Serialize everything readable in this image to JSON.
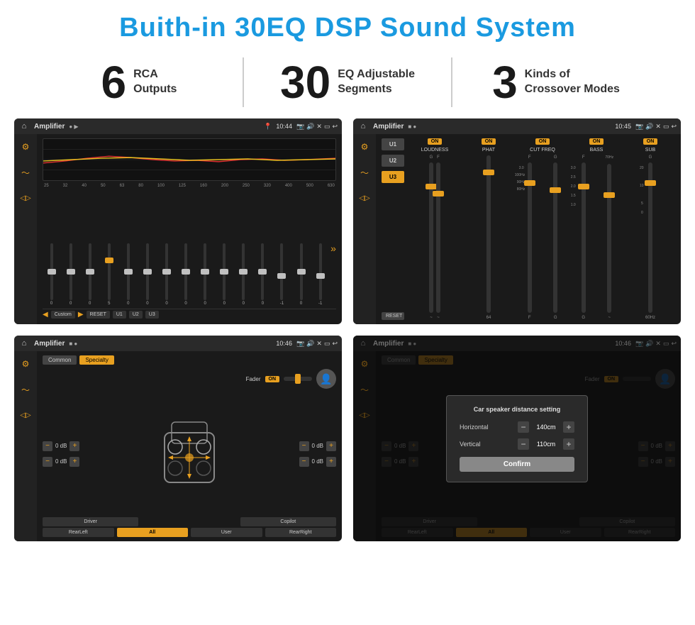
{
  "title": "Buith-in 30EQ DSP Sound System",
  "stats": [
    {
      "number": "6",
      "label": "RCA\nOutputs"
    },
    {
      "number": "30",
      "label": "EQ Adjustable\nSegments"
    },
    {
      "number": "3",
      "label": "Kinds of\nCrossover Modes"
    }
  ],
  "screens": [
    {
      "id": "eq-screen",
      "topbar": {
        "title": "Amplifier",
        "time": "10:44"
      },
      "type": "eq",
      "freq_labels": [
        "25",
        "32",
        "40",
        "50",
        "63",
        "80",
        "100",
        "125",
        "160",
        "200",
        "250",
        "320",
        "400",
        "500",
        "630"
      ],
      "eq_values": [
        "0",
        "0",
        "0",
        "5",
        "0",
        "0",
        "0",
        "0",
        "0",
        "0",
        "0",
        "0",
        "-1",
        "0",
        "-1"
      ],
      "bottom_btns": [
        "Custom",
        "RESET",
        "U1",
        "U2",
        "U3"
      ]
    },
    {
      "id": "crossover-screen",
      "topbar": {
        "title": "Amplifier",
        "time": "10:45"
      },
      "type": "crossover",
      "presets": [
        "U1",
        "U2",
        "U3"
      ],
      "columns": [
        {
          "label": "LOUDNESS",
          "on": true
        },
        {
          "label": "PHAT",
          "on": true
        },
        {
          "label": "CUT FREQ",
          "on": true
        },
        {
          "label": "BASS",
          "on": true
        },
        {
          "label": "SUB",
          "on": true
        }
      ]
    },
    {
      "id": "fader-screen",
      "topbar": {
        "title": "Amplifier",
        "time": "10:46"
      },
      "type": "fader",
      "tabs": [
        "Common",
        "Specialty"
      ],
      "active_tab": "Specialty",
      "fader_label": "Fader",
      "fader_on": "ON",
      "db_values_left": [
        "0 dB",
        "0 dB"
      ],
      "db_values_right": [
        "0 dB",
        "0 dB"
      ],
      "bottom_btns": [
        "Driver",
        "",
        "Copilot",
        "RearLeft",
        "All",
        "User",
        "RearRight"
      ],
      "active_bottom": "All"
    },
    {
      "id": "distance-screen",
      "topbar": {
        "title": "Amplifier",
        "time": "10:46"
      },
      "type": "fader-dialog",
      "tabs": [
        "Common",
        "Specialty"
      ],
      "active_tab": "Specialty",
      "dialog": {
        "title": "Car speaker distance setting",
        "rows": [
          {
            "label": "Horizontal",
            "value": "140cm"
          },
          {
            "label": "Vertical",
            "value": "110cm"
          }
        ],
        "confirm_label": "Confirm"
      },
      "db_values_right": [
        "0 dB",
        "0 dB"
      ],
      "bottom_btns": [
        "Driver",
        "",
        "Copilot",
        "RearLeft",
        "All",
        "User",
        "RearRight"
      ]
    }
  ],
  "colors": {
    "accent": "#e8a020",
    "title_blue": "#1a9ae0",
    "bg_dark": "#1a1a1a",
    "bg_medium": "#2a2a2a"
  }
}
